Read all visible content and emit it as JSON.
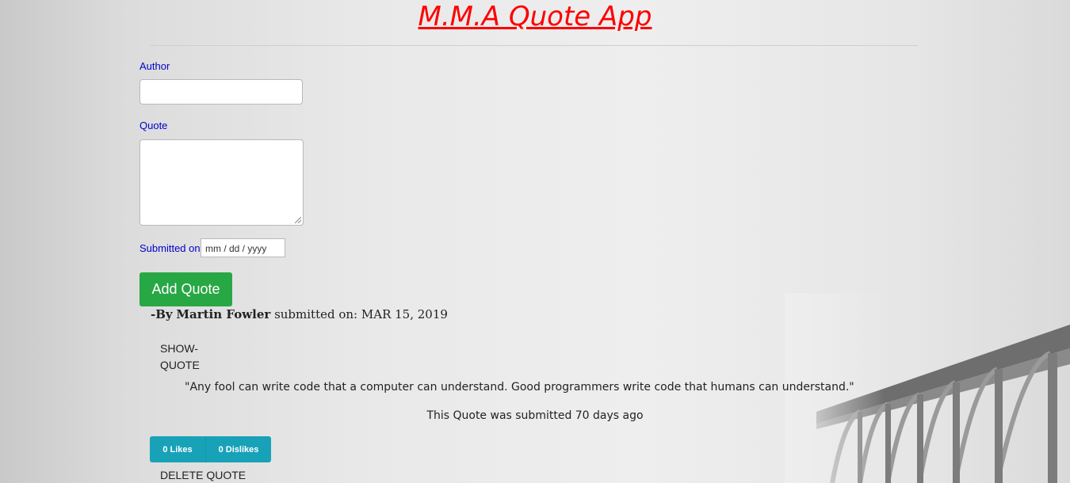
{
  "app": {
    "title": "M.M.A Quote App"
  },
  "form": {
    "author_label": "Author",
    "author_value": "",
    "quote_label": "Quote",
    "quote_value": "",
    "date_label": "Submitted on",
    "date_placeholder": "mm / dd / yyyy",
    "submit_label": "Add Quote"
  },
  "quote": {
    "by_prefix": "-By",
    "author": "Martin Fowler",
    "submitted_prefix": "submitted on:",
    "date": "MAR 15, 2019",
    "show_label": "SHOW-QUOTE",
    "text": "\"Any fool can write code that a computer can understand. Good programmers write code that humans can understand.\"",
    "age_text": "This Quote was submitted 70 days ago",
    "likes_label": "0 Likes",
    "dislikes_label": "0 Dislikes",
    "delete_label": "DELETE QUOTE"
  },
  "colors": {
    "title": "#ff0000",
    "labels": "#0000cd",
    "add_button": "#28a745",
    "vote_buttons": "#17a2b8"
  }
}
